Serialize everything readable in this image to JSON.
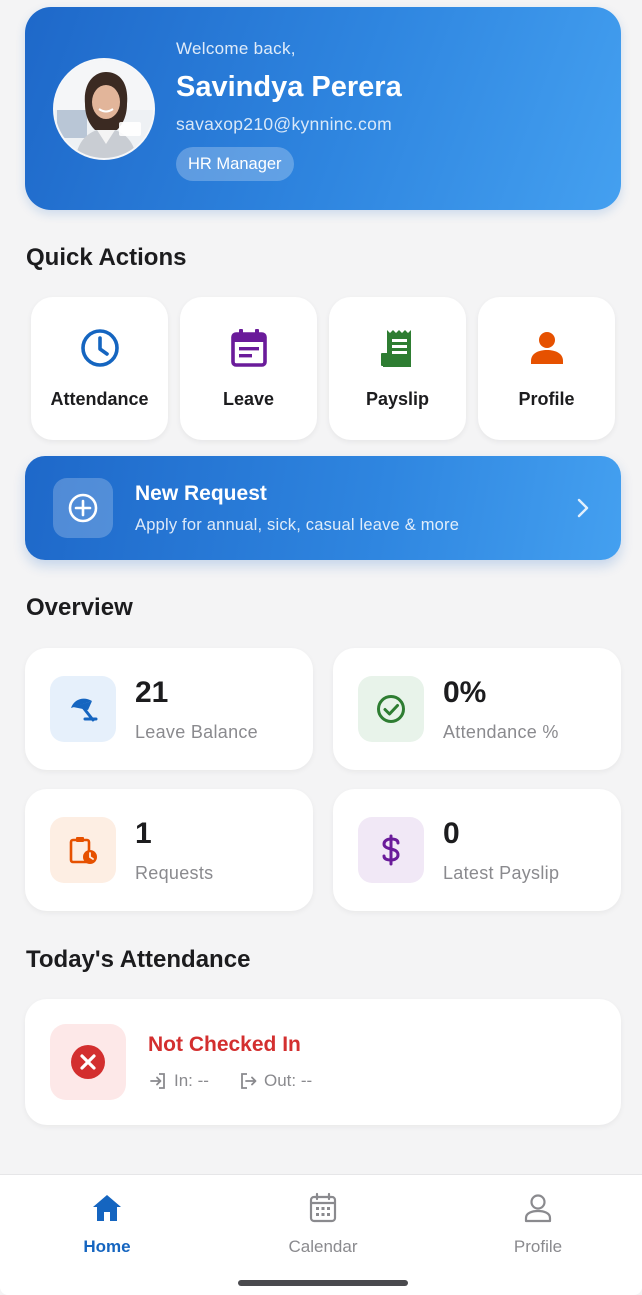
{
  "header": {
    "welcome": "Welcome back,",
    "name": "Savindya Perera",
    "email": "savaxop210@kynninc.com",
    "role": "HR Manager",
    "avatar_icon": "user-photo-avatar"
  },
  "quick_actions": {
    "title": "Quick Actions",
    "items": [
      {
        "label": "Attendance",
        "icon": "clock-icon",
        "color": "#1565c0"
      },
      {
        "label": "Leave",
        "icon": "calendar-icon",
        "color": "#6a1b9a"
      },
      {
        "label": "Payslip",
        "icon": "receipt-icon",
        "color": "#2e7d32"
      },
      {
        "label": "Profile",
        "icon": "person-icon",
        "color": "#e65100"
      }
    ]
  },
  "new_request": {
    "title": "New Request",
    "subtitle": "Apply for annual, sick, casual leave & more",
    "icon": "add-circle-icon"
  },
  "overview": {
    "title": "Overview",
    "stats": [
      {
        "value": "21",
        "label": "Leave Balance",
        "icon": "beach-umbrella-icon",
        "color": "#1565c0",
        "bg": "#e6f0fb"
      },
      {
        "value": "0%",
        "label": "Attendance %",
        "icon": "check-circle-icon",
        "color": "#2e7d32",
        "bg": "#e8f3ea"
      },
      {
        "value": "1",
        "label": "Requests",
        "icon": "pending-clipboard-icon",
        "color": "#e65100",
        "bg": "#fdeee3"
      },
      {
        "value": "0",
        "label": "Latest Payslip",
        "icon": "dollar-icon",
        "color": "#6a1b9a",
        "bg": "#f1e8f6"
      }
    ]
  },
  "attendance": {
    "title": "Today's Attendance",
    "status": "Not Checked In",
    "status_color": "#d32f2f",
    "in_text": "In: --",
    "out_text": "Out: --"
  },
  "nav": {
    "items": [
      {
        "label": "Home",
        "icon": "home-icon",
        "active": true
      },
      {
        "label": "Calendar",
        "icon": "calendar-icon",
        "active": false
      },
      {
        "label": "Profile",
        "icon": "person-outline-icon",
        "active": false
      }
    ],
    "active_color": "#1565c0",
    "inactive_color": "#8a8a8e"
  }
}
